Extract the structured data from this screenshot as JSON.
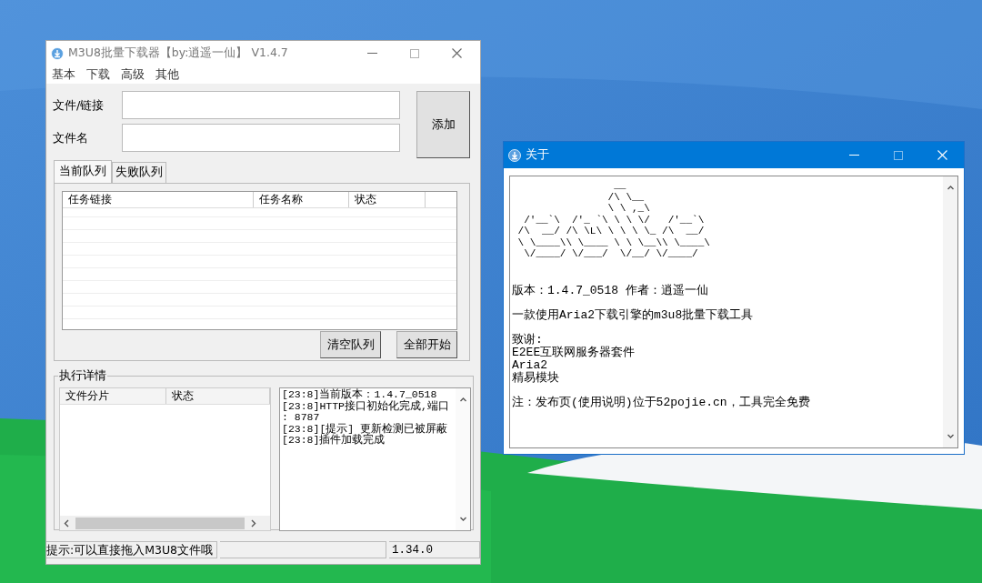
{
  "main_window": {
    "title": "M3U8批量下载器【by:逍遥一仙】 V1.4.7",
    "menu": [
      "基本",
      "下载",
      "高级",
      "其他"
    ],
    "fields": [
      {
        "label": "文件/链接"
      },
      {
        "label": "文件名"
      }
    ],
    "add_button": "添加",
    "tabs": [
      {
        "label": "当前队列",
        "selected": true
      },
      {
        "label": "失败队列",
        "selected": false
      }
    ],
    "queue_columns": [
      "任务链接",
      "任务名称",
      "状态"
    ],
    "queue_buttons": [
      "清空队列",
      "全部开始"
    ],
    "details": {
      "title": "执行详情",
      "columns": [
        "文件分片",
        "状态"
      ],
      "log": [
        "[23:8]当前版本：1.4.7_0518",
        "[23:8]HTTP接口初始化完成,端口",
        ": 8787",
        "[23:8][提示] 更新检测已被屏蔽",
        "[23:8]插件加载完成"
      ]
    },
    "status_bar": [
      "提示:可以直接拖入M3U8文件哦",
      "1.34.0"
    ]
  },
  "about_window": {
    "title": "关于",
    "ascii_art": [
      "                 __",
      "                /\\ \\__",
      "                \\ \\ ,_\\",
      "  /'__`\\  /'_ `\\ \\ \\ \\/   /'__`\\",
      " /\\  __/ /\\ \\L\\ \\ \\ \\ \\_ /\\  __/",
      " \\ \\____\\\\ \\____ \\ \\ \\__\\\\ \\____\\",
      "  \\/____/ \\/___/  \\/__/ \\/____/"
    ],
    "paragraphs": [
      [
        "版本：1.4.7_0518  作者：逍遥一仙"
      ],
      [
        "一款使用Aria2下载引擎的m3u8批量下载工具"
      ],
      [
        "致谢:",
        "E2EE互联网服务器套件",
        "Aria2",
        "精易模块"
      ],
      [
        "注：发布页(使用说明)位于52pojie.cn，工具完全免费"
      ]
    ]
  }
}
